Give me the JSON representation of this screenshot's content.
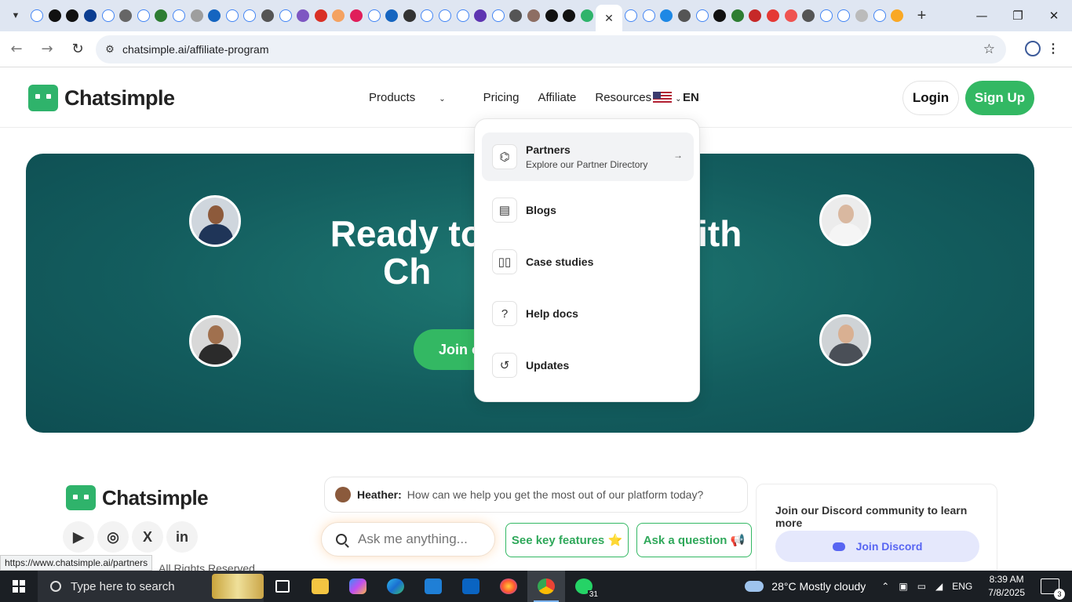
{
  "browser": {
    "tab_favicons": [
      {
        "icon": "google-g-icon",
        "color": "#4285f4",
        "kind": "g"
      },
      {
        "icon": "openai-icon",
        "color": "#111111"
      },
      {
        "icon": "openai-icon",
        "color": "#111111"
      },
      {
        "icon": "ttp-icon",
        "color": "#0b3d91"
      },
      {
        "icon": "google-g-icon",
        "color": "#4285f4",
        "kind": "g"
      },
      {
        "icon": "b-icon",
        "color": "#666666"
      },
      {
        "icon": "google-g-icon",
        "color": "#4285f4",
        "kind": "g"
      },
      {
        "icon": "globe-green-icon",
        "color": "#2e7d32"
      },
      {
        "icon": "google-g-icon",
        "color": "#4285f4",
        "kind": "g"
      },
      {
        "icon": "bot-icon",
        "color": "#9e9e9e"
      },
      {
        "icon": "xf-icon",
        "color": "#1565c0"
      },
      {
        "icon": "google-g-icon",
        "color": "#4285f4",
        "kind": "g"
      },
      {
        "icon": "google-g-icon",
        "color": "#4285f4",
        "kind": "g"
      },
      {
        "icon": "globe-icon",
        "color": "#555555"
      },
      {
        "icon": "google-g-icon",
        "color": "#4285f4",
        "kind": "g"
      },
      {
        "icon": "g-circle-icon",
        "color": "#7e57c2"
      },
      {
        "icon": "gmail-icon",
        "color": "#d93025"
      },
      {
        "icon": "palette-icon",
        "color": "#f4a261"
      },
      {
        "icon": "slack-icon",
        "color": "#e01e5a"
      },
      {
        "icon": "google-g-icon",
        "color": "#4285f4",
        "kind": "g"
      },
      {
        "icon": "b-italic-icon",
        "color": "#1565c0"
      },
      {
        "icon": "layers-icon",
        "color": "#333333"
      },
      {
        "icon": "google-g-icon",
        "color": "#4285f4",
        "kind": "g"
      },
      {
        "icon": "google-g-icon",
        "color": "#4285f4",
        "kind": "g"
      },
      {
        "icon": "google-g-icon",
        "color": "#4285f4",
        "kind": "g"
      },
      {
        "icon": "circle-purple-icon",
        "color": "#5e35b1"
      },
      {
        "icon": "google-g-icon",
        "color": "#4285f4",
        "kind": "g"
      },
      {
        "icon": "globe-icon",
        "color": "#555555"
      },
      {
        "icon": "people-icon",
        "color": "#8d6e63"
      },
      {
        "icon": "github-icon",
        "color": "#111111"
      },
      {
        "icon": "m-icon",
        "color": "#111111"
      },
      {
        "icon": "chat-green-icon",
        "color": "#2fb36b"
      }
    ],
    "active_tab_close": "✕",
    "tab_favicons_right": [
      {
        "icon": "google-g-icon",
        "color": "#4285f4",
        "kind": "g"
      },
      {
        "icon": "google-g-icon",
        "color": "#4285f4",
        "kind": "g"
      },
      {
        "icon": "swirl-icon",
        "color": "#1e88e5"
      },
      {
        "icon": "globe-icon",
        "color": "#555555"
      },
      {
        "icon": "google-g-icon",
        "color": "#4285f4",
        "kind": "g"
      },
      {
        "icon": "notion-icon",
        "color": "#111111"
      },
      {
        "icon": "chart-icon",
        "color": "#2e7d32"
      },
      {
        "icon": "flag-icon",
        "color": "#c62828"
      },
      {
        "icon": "opera-icon",
        "color": "#e53935"
      },
      {
        "icon": "stripes-icon",
        "color": "#ef5350"
      },
      {
        "icon": "globe-icon",
        "color": "#555555"
      },
      {
        "icon": "google-g-icon",
        "color": "#4285f4",
        "kind": "g"
      },
      {
        "icon": "google-g-icon",
        "color": "#4285f4",
        "kind": "g"
      },
      {
        "icon": "pen-icon",
        "color": "#bbbbbb"
      },
      {
        "icon": "google-g-icon",
        "color": "#4285f4",
        "kind": "g"
      },
      {
        "icon": "warning-icon",
        "color": "#f9a825"
      }
    ],
    "new_tab": "+",
    "url": "chatsimple.ai/affiliate-program",
    "status_url": "https://www.chatsimple.ai/partners"
  },
  "site": {
    "logo_text": "Chatsimple",
    "brand_color": "#33b863",
    "nav": {
      "products": "Products",
      "pricing": "Pricing",
      "affiliate": "Affiliate",
      "resources": "Resources",
      "lang": "EN"
    },
    "login": "Login",
    "signup": "Sign Up",
    "hero": {
      "title_line1_left": "Ready to s",
      "title_line1_right": "with",
      "title_line2": "Ch",
      "cta": "Join o"
    },
    "resources_menu": [
      {
        "label": "Partners",
        "desc": "Explore our Partner Directory",
        "icon": "partners-icon"
      },
      {
        "label": "Blogs",
        "desc": "",
        "icon": "document-icon"
      },
      {
        "label": "Case studies",
        "desc": "",
        "icon": "book-icon"
      },
      {
        "label": "Help docs",
        "desc": "",
        "icon": "question-icon"
      },
      {
        "label": "Updates",
        "desc": "",
        "icon": "history-icon"
      }
    ],
    "footer": {
      "logo_text": "Chatsimple",
      "copyright": "All Rights Reserved",
      "social": [
        "youtube-icon",
        "instagram-icon",
        "x-icon",
        "linkedin-icon"
      ]
    },
    "chat": {
      "agent": "Heather:",
      "message": "How can we help you get the most out of our platform today?",
      "input_placeholder": "Ask me anything...",
      "btn_features": "See key features ⭐",
      "btn_question": "Ask a question 📢"
    },
    "discord": {
      "title": "Join our Discord community to learn more",
      "button": "Join Discord"
    }
  },
  "taskbar": {
    "search_placeholder": "Type here to search",
    "whatsapp_badge": "31",
    "weather": "28°C  Mostly cloudy",
    "lang": "ENG",
    "time": "8:39 AM",
    "date": "7/8/2025",
    "notifications": "3"
  }
}
